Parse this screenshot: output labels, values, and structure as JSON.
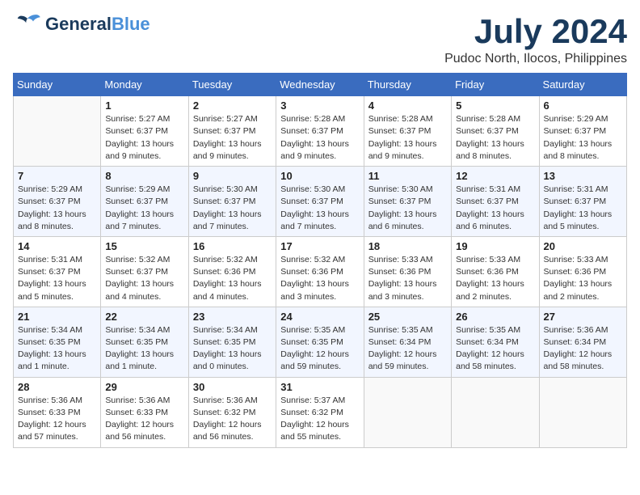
{
  "logo": {
    "general": "General",
    "blue": "Blue"
  },
  "title": "July 2024",
  "location": "Pudoc North, Ilocos, Philippines",
  "days_of_week": [
    "Sunday",
    "Monday",
    "Tuesday",
    "Wednesday",
    "Thursday",
    "Friday",
    "Saturday"
  ],
  "weeks": [
    {
      "shade": "white",
      "days": [
        {
          "num": "",
          "info": ""
        },
        {
          "num": "1",
          "info": "Sunrise: 5:27 AM\nSunset: 6:37 PM\nDaylight: 13 hours\nand 9 minutes."
        },
        {
          "num": "2",
          "info": "Sunrise: 5:27 AM\nSunset: 6:37 PM\nDaylight: 13 hours\nand 9 minutes."
        },
        {
          "num": "3",
          "info": "Sunrise: 5:28 AM\nSunset: 6:37 PM\nDaylight: 13 hours\nand 9 minutes."
        },
        {
          "num": "4",
          "info": "Sunrise: 5:28 AM\nSunset: 6:37 PM\nDaylight: 13 hours\nand 9 minutes."
        },
        {
          "num": "5",
          "info": "Sunrise: 5:28 AM\nSunset: 6:37 PM\nDaylight: 13 hours\nand 8 minutes."
        },
        {
          "num": "6",
          "info": "Sunrise: 5:29 AM\nSunset: 6:37 PM\nDaylight: 13 hours\nand 8 minutes."
        }
      ]
    },
    {
      "shade": "shade",
      "days": [
        {
          "num": "7",
          "info": "Sunrise: 5:29 AM\nSunset: 6:37 PM\nDaylight: 13 hours\nand 8 minutes."
        },
        {
          "num": "8",
          "info": "Sunrise: 5:29 AM\nSunset: 6:37 PM\nDaylight: 13 hours\nand 7 minutes."
        },
        {
          "num": "9",
          "info": "Sunrise: 5:30 AM\nSunset: 6:37 PM\nDaylight: 13 hours\nand 7 minutes."
        },
        {
          "num": "10",
          "info": "Sunrise: 5:30 AM\nSunset: 6:37 PM\nDaylight: 13 hours\nand 7 minutes."
        },
        {
          "num": "11",
          "info": "Sunrise: 5:30 AM\nSunset: 6:37 PM\nDaylight: 13 hours\nand 6 minutes."
        },
        {
          "num": "12",
          "info": "Sunrise: 5:31 AM\nSunset: 6:37 PM\nDaylight: 13 hours\nand 6 minutes."
        },
        {
          "num": "13",
          "info": "Sunrise: 5:31 AM\nSunset: 6:37 PM\nDaylight: 13 hours\nand 5 minutes."
        }
      ]
    },
    {
      "shade": "white",
      "days": [
        {
          "num": "14",
          "info": "Sunrise: 5:31 AM\nSunset: 6:37 PM\nDaylight: 13 hours\nand 5 minutes."
        },
        {
          "num": "15",
          "info": "Sunrise: 5:32 AM\nSunset: 6:37 PM\nDaylight: 13 hours\nand 4 minutes."
        },
        {
          "num": "16",
          "info": "Sunrise: 5:32 AM\nSunset: 6:36 PM\nDaylight: 13 hours\nand 4 minutes."
        },
        {
          "num": "17",
          "info": "Sunrise: 5:32 AM\nSunset: 6:36 PM\nDaylight: 13 hours\nand 3 minutes."
        },
        {
          "num": "18",
          "info": "Sunrise: 5:33 AM\nSunset: 6:36 PM\nDaylight: 13 hours\nand 3 minutes."
        },
        {
          "num": "19",
          "info": "Sunrise: 5:33 AM\nSunset: 6:36 PM\nDaylight: 13 hours\nand 2 minutes."
        },
        {
          "num": "20",
          "info": "Sunrise: 5:33 AM\nSunset: 6:36 PM\nDaylight: 13 hours\nand 2 minutes."
        }
      ]
    },
    {
      "shade": "shade",
      "days": [
        {
          "num": "21",
          "info": "Sunrise: 5:34 AM\nSunset: 6:35 PM\nDaylight: 13 hours\nand 1 minute."
        },
        {
          "num": "22",
          "info": "Sunrise: 5:34 AM\nSunset: 6:35 PM\nDaylight: 13 hours\nand 1 minute."
        },
        {
          "num": "23",
          "info": "Sunrise: 5:34 AM\nSunset: 6:35 PM\nDaylight: 13 hours\nand 0 minutes."
        },
        {
          "num": "24",
          "info": "Sunrise: 5:35 AM\nSunset: 6:35 PM\nDaylight: 12 hours\nand 59 minutes."
        },
        {
          "num": "25",
          "info": "Sunrise: 5:35 AM\nSunset: 6:34 PM\nDaylight: 12 hours\nand 59 minutes."
        },
        {
          "num": "26",
          "info": "Sunrise: 5:35 AM\nSunset: 6:34 PM\nDaylight: 12 hours\nand 58 minutes."
        },
        {
          "num": "27",
          "info": "Sunrise: 5:36 AM\nSunset: 6:34 PM\nDaylight: 12 hours\nand 58 minutes."
        }
      ]
    },
    {
      "shade": "white",
      "days": [
        {
          "num": "28",
          "info": "Sunrise: 5:36 AM\nSunset: 6:33 PM\nDaylight: 12 hours\nand 57 minutes."
        },
        {
          "num": "29",
          "info": "Sunrise: 5:36 AM\nSunset: 6:33 PM\nDaylight: 12 hours\nand 56 minutes."
        },
        {
          "num": "30",
          "info": "Sunrise: 5:36 AM\nSunset: 6:32 PM\nDaylight: 12 hours\nand 56 minutes."
        },
        {
          "num": "31",
          "info": "Sunrise: 5:37 AM\nSunset: 6:32 PM\nDaylight: 12 hours\nand 55 minutes."
        },
        {
          "num": "",
          "info": ""
        },
        {
          "num": "",
          "info": ""
        },
        {
          "num": "",
          "info": ""
        }
      ]
    }
  ]
}
